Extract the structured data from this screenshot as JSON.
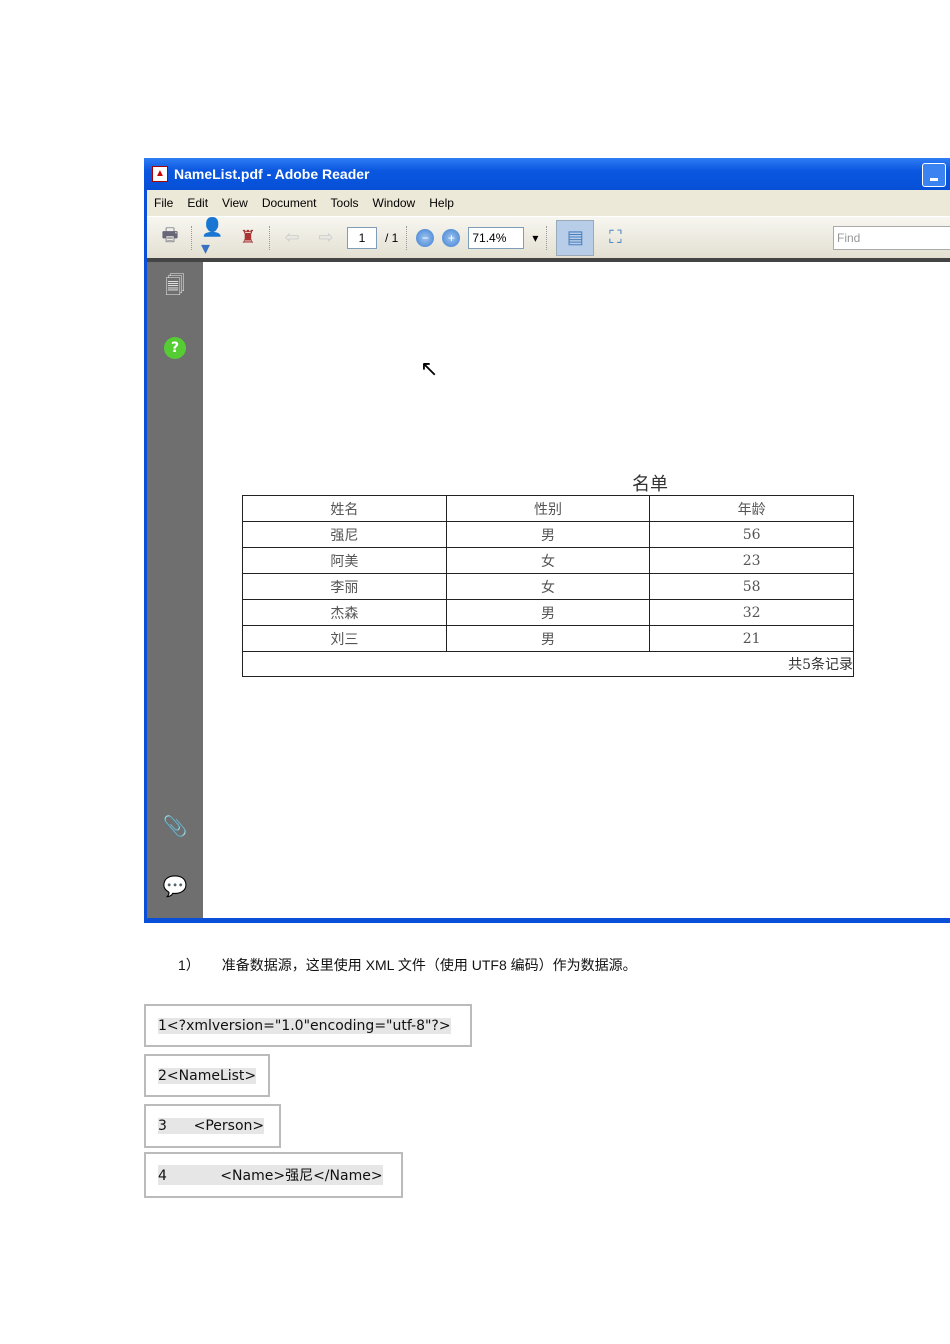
{
  "window": {
    "title": "NameList.pdf - Adobe Reader"
  },
  "menu": [
    "File",
    "Edit",
    "View",
    "Document",
    "Tools",
    "Window",
    "Help"
  ],
  "toolbar": {
    "page": "1",
    "page_total": "/ 1",
    "zoom": "71.4%",
    "find_placeholder": "Find"
  },
  "document": {
    "title": "名单",
    "headers": [
      "姓名",
      "性别",
      "年龄"
    ],
    "rows": [
      [
        "强尼",
        "男",
        "56"
      ],
      [
        "阿美",
        "女",
        "23"
      ],
      [
        "李丽",
        "女",
        "58"
      ],
      [
        "杰森",
        "男",
        "32"
      ],
      [
        "刘三",
        "男",
        "21"
      ]
    ],
    "footer": "共5条记录"
  },
  "paragraph": {
    "number": "1）",
    "text": "准备数据源，这里使用 XML 文件（使用 UTF8 编码）作为数据源。"
  },
  "code_lines": [
    "1<?xmlversion=\"1.0\"encoding=\"utf-8\"?>",
    "2<NameList>",
    "3      <Person>",
    "4            <Name>强尼</Name>"
  ]
}
